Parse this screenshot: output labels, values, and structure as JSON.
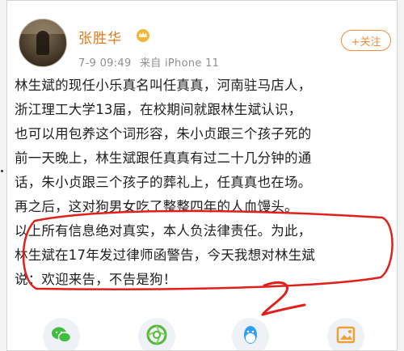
{
  "user": {
    "name": "张胜华"
  },
  "meta": {
    "date": "7-9 09:49",
    "source": "来自 iPhone 11"
  },
  "follow_button": {
    "label": "+关注"
  },
  "post": {
    "lines": [
      "林生斌的现任小乐真名叫任真真，河南驻马店人，",
      "浙江理工大学13届，在校期间就跟林生斌认识，",
      "也可以用包养这个词形容，朱小贞跟三个孩子死的",
      "前一天晚上，林生斌跟任真真有过二十几分钟的通",
      "话，朱小贞跟三个孩子的葬礼上，任真真也在场。",
      "再之后，这对狗男女吃了整整四年的人血馒头。",
      "以上所有信息绝对真实，本人负法律责任。为此，",
      "林生斌在17年发过律师函警告，今天我想对林生斌",
      "说：欢迎来告，不告是狗！"
    ]
  },
  "annotation": {
    "mark": "2",
    "color": "#e0201b"
  },
  "colors": {
    "accent": "#f08b3b",
    "name": "#e07a17"
  },
  "share_bar": {
    "icons": [
      "wechat-icon",
      "moments-icon",
      "qq-icon",
      "image-share-icon"
    ]
  }
}
